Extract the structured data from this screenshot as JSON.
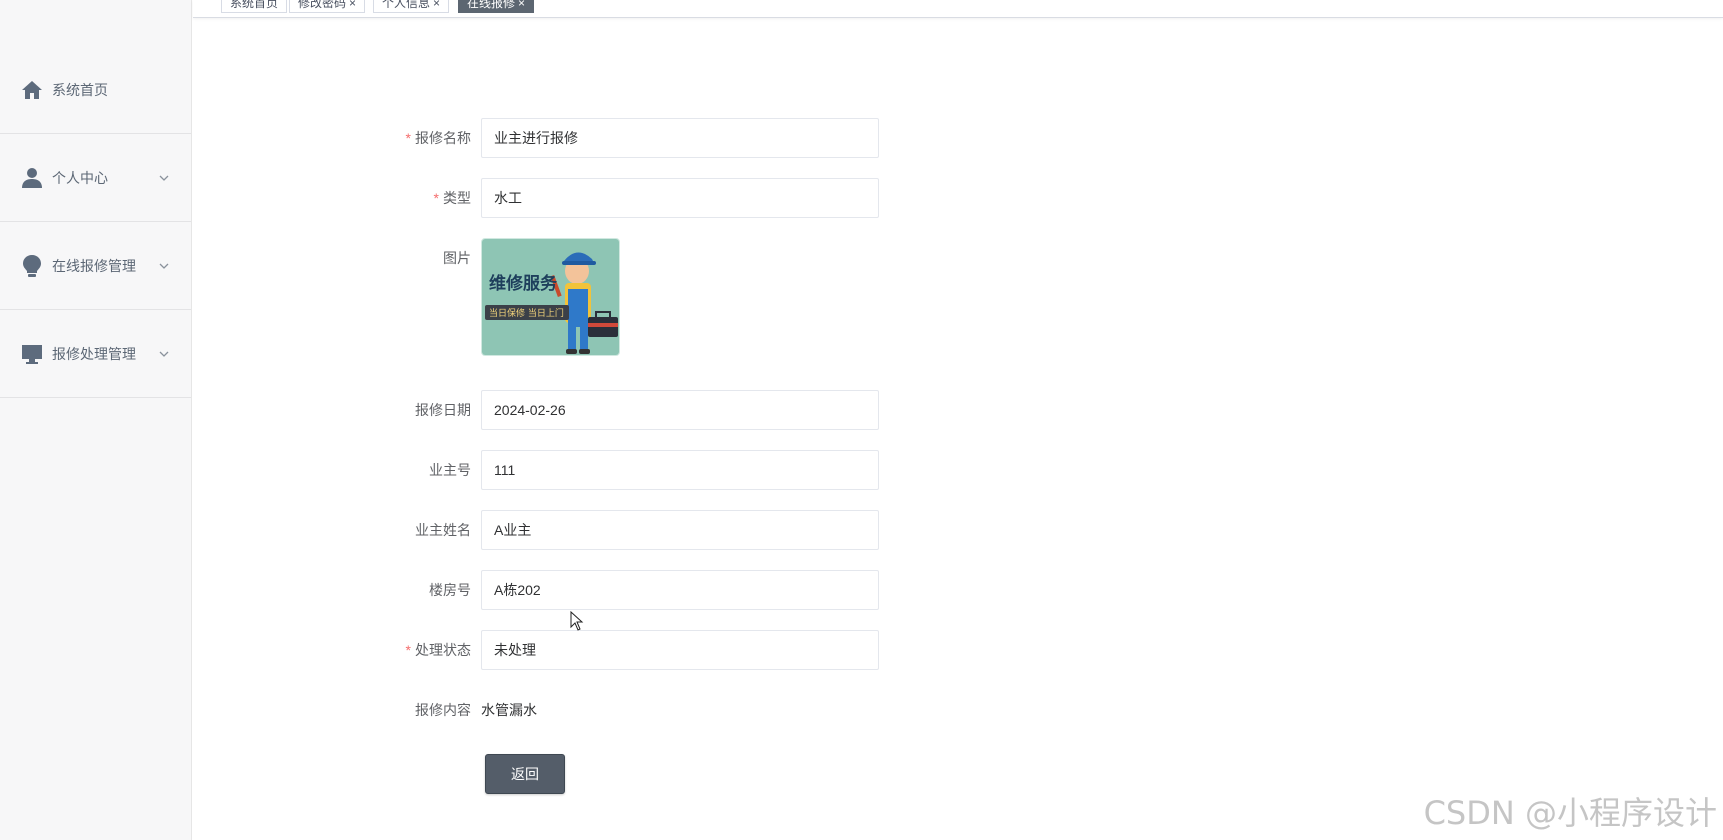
{
  "sidebar": {
    "items": [
      {
        "label": "系统首页",
        "icon": "home-icon",
        "has_chevron": false
      },
      {
        "label": "个人中心",
        "icon": "user-icon",
        "has_chevron": true
      },
      {
        "label": "在线报修管理",
        "icon": "bulb-icon",
        "has_chevron": true
      },
      {
        "label": "报修处理管理",
        "icon": "monitor-icon",
        "has_chevron": true
      }
    ]
  },
  "tabs": [
    {
      "label": "系统首页",
      "closable": false,
      "active": false
    },
    {
      "label": "修改密码",
      "closable": true,
      "active": false
    },
    {
      "label": "个人信息",
      "closable": true,
      "active": false
    },
    {
      "label": "在线报修",
      "closable": true,
      "active": true
    }
  ],
  "tab_close_glyph": "×",
  "form": {
    "name": {
      "label": "报修名称",
      "required": true,
      "value": "业主进行报修"
    },
    "type": {
      "label": "类型",
      "required": true,
      "value": "水工"
    },
    "image": {
      "label": "图片",
      "caption_title": "维修服务",
      "caption_sub": "当日保修 当日上门"
    },
    "date": {
      "label": "报修日期",
      "required": false,
      "value": "2024-02-26"
    },
    "owner_no": {
      "label": "业主号",
      "required": false,
      "value": "111"
    },
    "owner_name": {
      "label": "业主姓名",
      "required": false,
      "value": "A业主"
    },
    "building": {
      "label": "楼房号",
      "required": false,
      "value": "A栋202"
    },
    "status": {
      "label": "处理状态",
      "required": true,
      "value": "未处理"
    },
    "content": {
      "label": "报修内容",
      "value": "水管漏水"
    }
  },
  "required_mark": "*",
  "back_button": {
    "label": "返回"
  },
  "watermark": "CSDN @小程序设计",
  "colors": {
    "accent": "#545d69",
    "required": "#f56c6c",
    "sidebar_bg": "#f7f7f8",
    "image_bg": "#8ec5b4"
  }
}
